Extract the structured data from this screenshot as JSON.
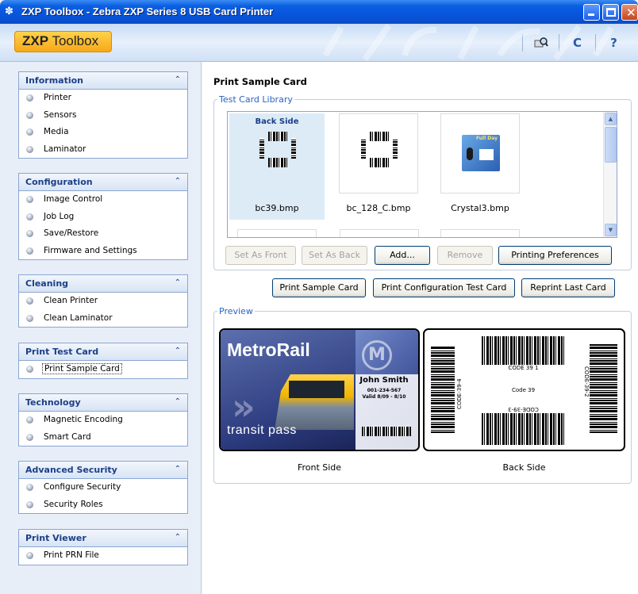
{
  "window": {
    "title": "ZXP Toolbox - Zebra ZXP Series 8 USB Card Printer"
  },
  "header": {
    "logo_bold": "ZXP",
    "logo_rest": " Toolbox",
    "refresh_glyph": "C",
    "help_glyph": "?"
  },
  "sidebar": {
    "groups": [
      {
        "title": "Information",
        "items": [
          "Printer",
          "Sensors",
          "Media",
          "Laminator"
        ]
      },
      {
        "title": "Configuration",
        "items": [
          "Image Control",
          "Job Log",
          "Save/Restore",
          "Firmware and Settings"
        ]
      },
      {
        "title": "Cleaning",
        "items": [
          "Clean Printer",
          "Clean Laminator"
        ]
      },
      {
        "title": "Print Test Card",
        "items": [
          "Print Sample Card"
        ]
      },
      {
        "title": "Technology",
        "items": [
          "Magnetic Encoding",
          "Smart Card"
        ]
      },
      {
        "title": "Advanced Security",
        "items": [
          "Configure Security",
          "Security Roles"
        ]
      },
      {
        "title": "Print Viewer",
        "items": [
          "Print PRN File"
        ]
      }
    ],
    "selected_item": "Print Sample Card"
  },
  "main": {
    "title": "Print Sample Card",
    "library": {
      "legend": "Test Card Library",
      "thumbs": [
        {
          "name": "bc39.bmp",
          "caption": "Back Side"
        },
        {
          "name": "bc_128_C.bmp"
        },
        {
          "name": "Crystal3.bmp",
          "caption": "Full Day"
        }
      ],
      "buttons": [
        "Set As Front",
        "Set As Back",
        "Add...",
        "Remove",
        "Printing Preferences"
      ]
    },
    "actions": [
      "Print Sample Card",
      "Print Configuration Test Card",
      "Reprint Last Card"
    ],
    "preview": {
      "legend": "Preview",
      "front": {
        "brand": "MetroRail",
        "name": "John Smith",
        "number": "001-234-567",
        "valid": "Valid 8/09 - 8/10",
        "footer": "transit pass",
        "logo_letter": "M",
        "caption": "Front Side"
      },
      "back": {
        "code_top": "CODE 39 1",
        "code_mid": "Code 39",
        "code_left": "CODE-39-4",
        "code_right": "CODE-39-2",
        "code_bottom": "CODE-39-3",
        "caption": "Back Side"
      }
    }
  },
  "colors": {
    "accent": "#2a62c4",
    "titlebar": "#0855dd",
    "group_title": "#1b3f87"
  }
}
